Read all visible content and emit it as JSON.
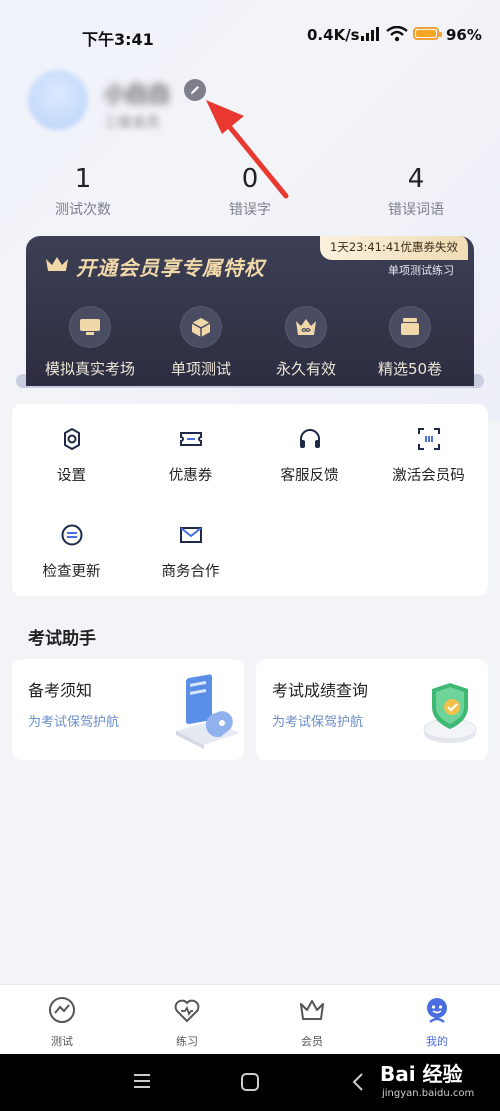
{
  "status_bar": {
    "time": "下午3:41",
    "speed": "0.4K/s",
    "battery": "96"
  },
  "profile": {
    "name": "小白白",
    "subtitle": "三级会员"
  },
  "stats": [
    {
      "value": "1",
      "label": "测试次数"
    },
    {
      "value": "0",
      "label": "错误字"
    },
    {
      "value": "4",
      "label": "错误词语"
    }
  ],
  "vip": {
    "title": "开通会员享专属特权",
    "promo_tag": "1天23:41:41优惠券失效",
    "promo_sub": "单项测试练习",
    "benefits": [
      {
        "label": "模拟真实考场",
        "icon": "monitor-icon"
      },
      {
        "label": "单项测试",
        "icon": "cube-icon"
      },
      {
        "label": "永久有效",
        "icon": "crown-infinity-icon"
      },
      {
        "label": "精选50卷",
        "icon": "stack-icon"
      }
    ]
  },
  "menu": [
    {
      "label": "设置",
      "icon": "gear-icon"
    },
    {
      "label": "优惠券",
      "icon": "coupon-icon"
    },
    {
      "label": "客服反馈",
      "icon": "headset-icon"
    },
    {
      "label": "激活会员码",
      "icon": "scan-icon"
    },
    {
      "label": "检查更新",
      "icon": "update-icon"
    },
    {
      "label": "商务合作",
      "icon": "mail-icon"
    }
  ],
  "assistant": {
    "title": "考试助手",
    "cards": [
      {
        "title": "备考须知",
        "subtitle": "为考试保驾护航"
      },
      {
        "title": "考试成绩查询",
        "subtitle": "为考试保驾护航"
      }
    ]
  },
  "tabs": [
    {
      "label": "测试",
      "icon": "test-icon"
    },
    {
      "label": "练习",
      "icon": "practice-icon"
    },
    {
      "label": "会员",
      "icon": "crown-icon"
    },
    {
      "label": "我的",
      "icon": "profile-icon",
      "active": true
    }
  ],
  "watermark": {
    "brand": "Bai 经验",
    "url": "jingyan.baidu.com"
  },
  "colors": {
    "accent": "#4a6ee0",
    "vip_gold": "#f1d8a8",
    "vip_bg": "#2c2d40",
    "annotation_red": "#e8382f"
  }
}
